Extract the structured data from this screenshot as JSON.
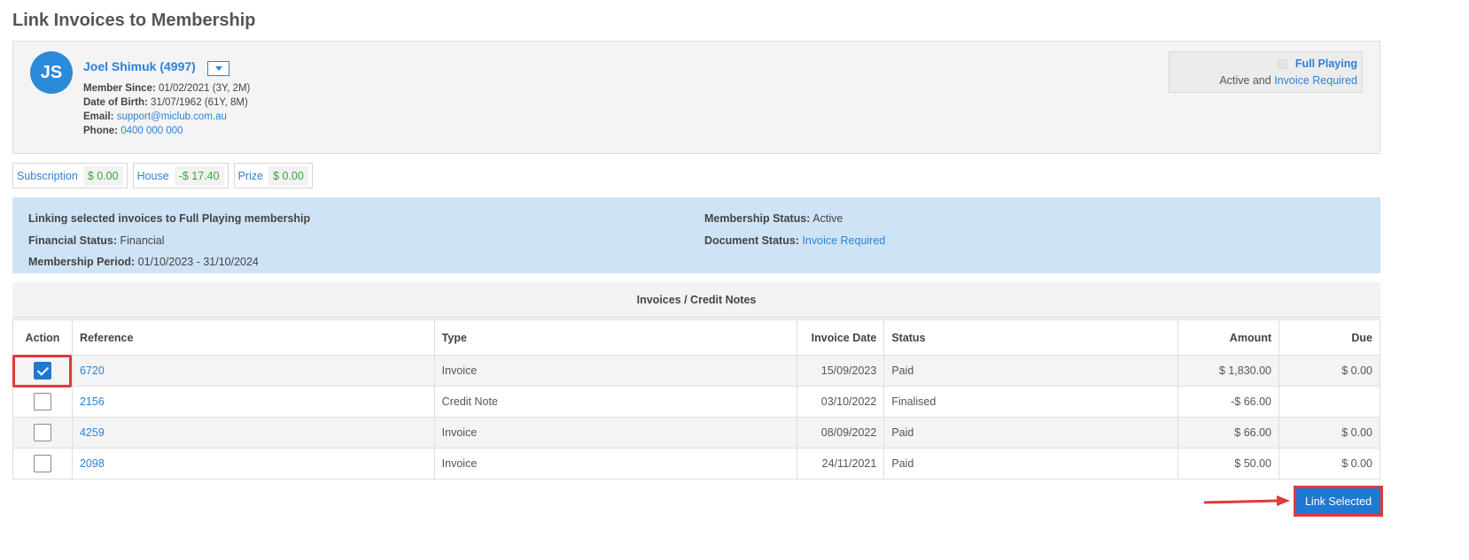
{
  "page": {
    "title": "Link Invoices to Membership"
  },
  "member": {
    "initials": "JS",
    "name": "Joel Shimuk (4997)",
    "member_since_label": "Member Since:",
    "member_since": "01/02/2021 (3Y, 2M)",
    "dob_label": "Date of Birth:",
    "dob": "31/07/1962 (61Y, 8M)",
    "email_label": "Email:",
    "email": "support@miclub.com.au",
    "phone_label": "Phone:",
    "phone": "0400 000 000"
  },
  "membership_box": {
    "type": "Full Playing",
    "status_prefix": "Active and",
    "status_link": "Invoice Required"
  },
  "balances": [
    {
      "label": "Subscription",
      "amount": "$ 0.00"
    },
    {
      "label": "House",
      "amount": "-$ 17.40"
    },
    {
      "label": "Prize",
      "amount": "$ 0.00"
    }
  ],
  "info": {
    "linking_text": "Linking selected invoices to Full Playing membership",
    "financial_status_label": "Financial Status:",
    "financial_status": "Financial",
    "period_label": "Membership Period:",
    "period": "01/10/2023 - 31/10/2024",
    "membership_status_label": "Membership Status:",
    "membership_status": "Active",
    "document_status_label": "Document Status:",
    "document_status": "Invoice Required"
  },
  "invoices": {
    "title": "Invoices / Credit Notes",
    "columns": [
      "Action",
      "Reference",
      "Type",
      "Invoice Date",
      "Status",
      "Amount",
      "Due"
    ],
    "rows": [
      {
        "checked": true,
        "reference": "6720",
        "type": "Invoice",
        "date": "15/09/2023",
        "status": "Paid",
        "amount": "$ 1,830.00",
        "due": "$ 0.00"
      },
      {
        "checked": false,
        "reference": "2156",
        "type": "Credit Note",
        "date": "03/10/2022",
        "status": "Finalised",
        "amount": "-$ 66.00",
        "due": ""
      },
      {
        "checked": false,
        "reference": "4259",
        "type": "Invoice",
        "date": "08/09/2022",
        "status": "Paid",
        "amount": "$ 66.00",
        "due": "$ 0.00"
      },
      {
        "checked": false,
        "reference": "2098",
        "type": "Invoice",
        "date": "24/11/2021",
        "status": "Paid",
        "amount": "$ 50.00",
        "due": "$ 0.00"
      }
    ]
  },
  "actions": {
    "link_selected": "Link Selected"
  },
  "colors": {
    "accent": "#2b82d9",
    "button": "#1f78d1",
    "highlight": "#e03a3a",
    "positive": "#3aa53a",
    "info_bg": "#cfe3f6"
  }
}
